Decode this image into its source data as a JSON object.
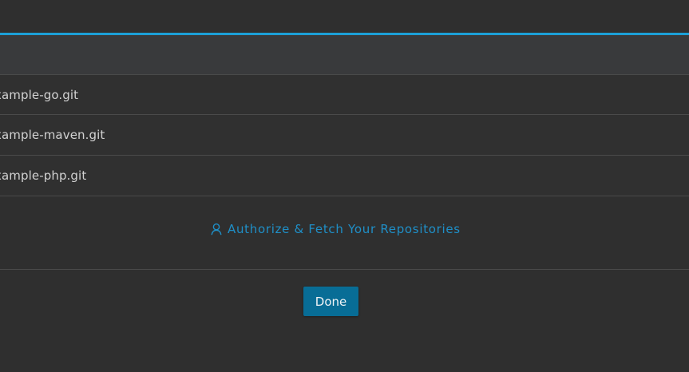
{
  "repositories": [
    {
      "name": "xample-go.git"
    },
    {
      "name": "xample-maven.git"
    },
    {
      "name": "xample-php.git"
    }
  ],
  "authorize": {
    "label": "Authorize & Fetch Your Repositories",
    "icon": "user-icon"
  },
  "footer": {
    "done_label": "Done"
  },
  "colors": {
    "accent": "#1ca0d8",
    "link": "#1f8fc7",
    "button_bg": "#086d96",
    "background": "#2f2f2f"
  }
}
